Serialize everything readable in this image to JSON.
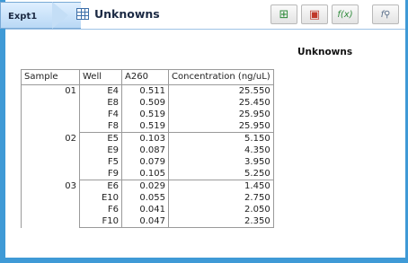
{
  "tab": {
    "label": "Expt1"
  },
  "header": {
    "title": "Unknowns"
  },
  "toolbar": [
    {
      "icon": "add-table-icon",
      "glyph": "⊞",
      "color": "#2e8a3a"
    },
    {
      "icon": "report-options-icon",
      "glyph": "▣",
      "color": "#c0392b"
    },
    {
      "icon": "add-formula-icon",
      "glyph": "f(x)",
      "color": "#2e8a3a"
    },
    {
      "icon": "formula-search-icon",
      "glyph": "f🔍",
      "color": "#5a6f8a"
    }
  ],
  "report": {
    "title": "Unknowns",
    "columns": [
      "Sample",
      "Well",
      "A260",
      "Concentration (ng/uL)"
    ],
    "groups": [
      {
        "sample": "01",
        "rows": [
          {
            "well": "E4",
            "a260": "0.511",
            "conc": "25.550"
          },
          {
            "well": "E8",
            "a260": "0.509",
            "conc": "25.450"
          },
          {
            "well": "F4",
            "a260": "0.519",
            "conc": "25.950"
          },
          {
            "well": "F8",
            "a260": "0.519",
            "conc": "25.950"
          }
        ]
      },
      {
        "sample": "02",
        "rows": [
          {
            "well": "E5",
            "a260": "0.103",
            "conc": "5.150"
          },
          {
            "well": "E9",
            "a260": "0.087",
            "conc": "4.350"
          },
          {
            "well": "F5",
            "a260": "0.079",
            "conc": "3.950"
          },
          {
            "well": "F9",
            "a260": "0.105",
            "conc": "5.250"
          }
        ]
      },
      {
        "sample": "03",
        "rows": [
          {
            "well": "E6",
            "a260": "0.029",
            "conc": "1.450"
          },
          {
            "well": "E10",
            "a260": "0.055",
            "conc": "2.750"
          },
          {
            "well": "F6",
            "a260": "0.041",
            "conc": "2.050"
          },
          {
            "well": "F10",
            "a260": "0.047",
            "conc": "2.350"
          }
        ]
      }
    ]
  }
}
